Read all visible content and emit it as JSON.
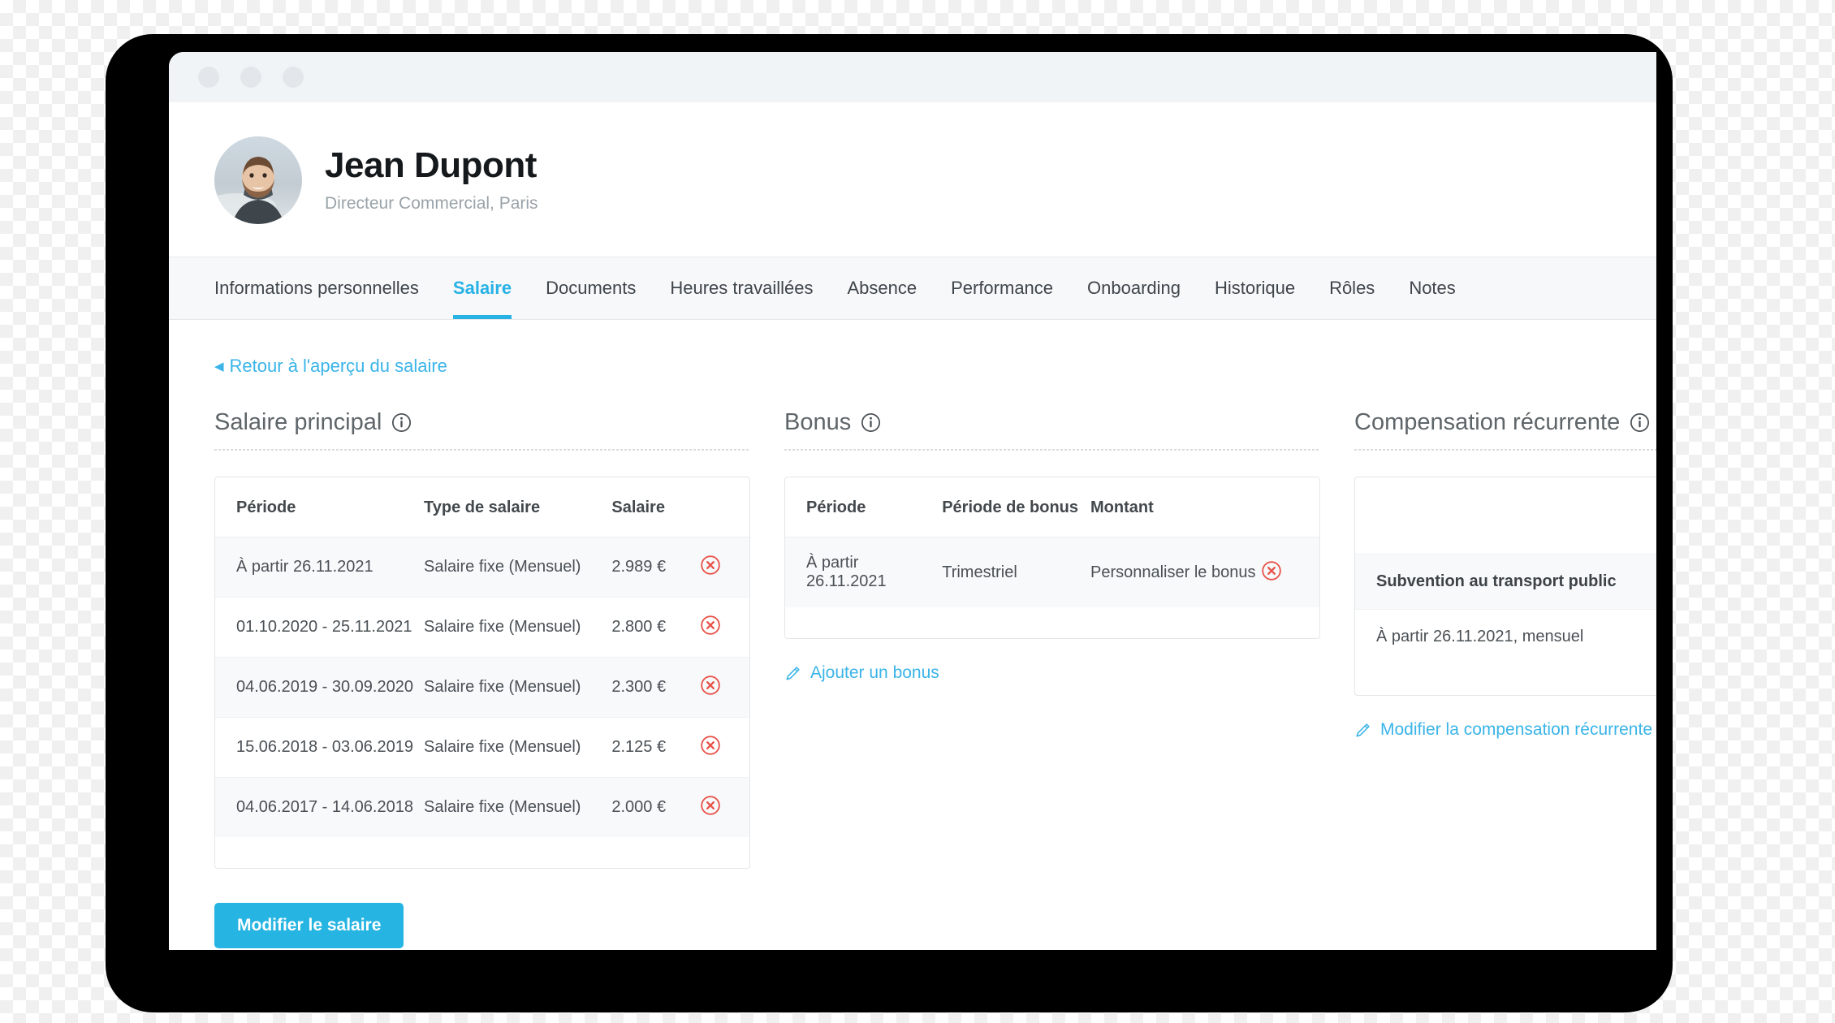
{
  "window": {
    "dots": [
      "close-dot",
      "minimize-dot",
      "maximize-dot"
    ]
  },
  "profile": {
    "name": "Jean Dupont",
    "role": "Directeur Commercial, Paris",
    "avatar_alt": "avatar-photo"
  },
  "tabs": [
    {
      "label": "Informations personnelles",
      "active": false
    },
    {
      "label": "Salaire",
      "active": true
    },
    {
      "label": "Documents",
      "active": false
    },
    {
      "label": "Heures travaillées",
      "active": false
    },
    {
      "label": "Absence",
      "active": false
    },
    {
      "label": "Performance",
      "active": false
    },
    {
      "label": "Onboarding",
      "active": false
    },
    {
      "label": "Historique",
      "active": false
    },
    {
      "label": "Rôles",
      "active": false
    },
    {
      "label": "Notes",
      "active": false
    }
  ],
  "back_link": {
    "caret": "◀",
    "label": "Retour à l'aperçu du salaire"
  },
  "salary_section": {
    "title": "Salaire principal",
    "columns": [
      "Période",
      "Type de salaire",
      "Salaire"
    ],
    "rows": [
      {
        "period": "À partir 26.11.2021",
        "type": "Salaire fixe (Mensuel)",
        "amount": "2.989 €"
      },
      {
        "period": "01.10.2020 - 25.11.2021",
        "type": "Salaire fixe (Mensuel)",
        "amount": "2.800 €"
      },
      {
        "period": "04.06.2019 - 30.09.2020",
        "type": "Salaire fixe (Mensuel)",
        "amount": "2.300 €"
      },
      {
        "period": "15.06.2018 - 03.06.2019",
        "type": "Salaire fixe (Mensuel)",
        "amount": "2.125 €"
      },
      {
        "period": "04.06.2017 - 14.06.2018",
        "type": "Salaire fixe (Mensuel)",
        "amount": "2.000 €"
      }
    ],
    "edit_button": "Modifier le salaire"
  },
  "bonus_section": {
    "title": "Bonus",
    "columns": [
      "Période",
      "Période de bonus",
      "Montant"
    ],
    "rows": [
      {
        "period": "À partir 26.11.2021",
        "bonus_period": "Trimestriel",
        "amount": "Personnaliser le bonus"
      }
    ],
    "add_link": "Ajouter un bonus"
  },
  "recurring_section": {
    "title": "Compensation récurrente",
    "rows": [
      {
        "name": "Subvention au transport public",
        "detail": "À partir 26.11.2021, mensuel"
      }
    ],
    "edit_link": "Modifier la compensation récurrente"
  },
  "colors": {
    "accent": "#27b2e6",
    "danger": "#e8534a",
    "titlebar": "#f1f4f7",
    "tabbar": "#f7f8f9",
    "text": "#4a5055"
  }
}
